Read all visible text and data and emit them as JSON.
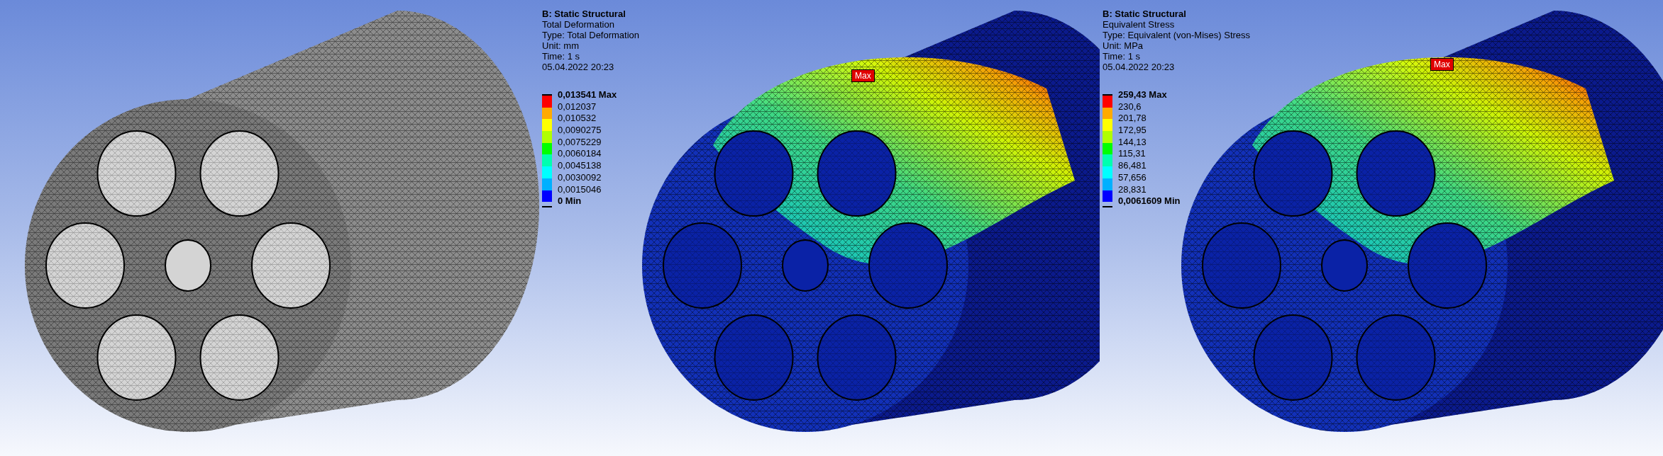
{
  "views": [
    {
      "kind": "mesh"
    },
    {
      "kind": "result",
      "legend": {
        "title": "B: Static Structural",
        "lines": [
          "Total Deformation",
          "Type: Total Deformation",
          "Unit: mm",
          "Time: 1 s",
          "05.04.2022 20:23"
        ],
        "labels": [
          "0,013541 Max",
          "0,012037",
          "0,010532",
          "0,0090275",
          "0,0075229",
          "0,0060184",
          "0,0045138",
          "0,0030092",
          "0,0015046",
          "0 Min"
        ],
        "bands": [
          {
            "color": "#ff0000"
          },
          {
            "color": "#ffaa00"
          },
          {
            "color": "#ffff00"
          },
          {
            "color": "#b0ff00"
          },
          {
            "color": "#00ff00"
          },
          {
            "color": "#00ffb0"
          },
          {
            "color": "#00ffff"
          },
          {
            "color": "#00b0ff"
          },
          {
            "color": "#0000ff"
          }
        ]
      },
      "max_tag": "Max"
    },
    {
      "kind": "result",
      "legend": {
        "title": "B: Static Structural",
        "lines": [
          "Equivalent Stress",
          "Type: Equivalent (von-Mises) Stress",
          "Unit: MPa",
          "Time: 1 s",
          "05.04.2022 20:23"
        ],
        "labels": [
          "259,43 Max",
          "230,6",
          "201,78",
          "172,95",
          "144,13",
          "115,31",
          "86,481",
          "57,656",
          "28,831",
          "0,0061609 Min"
        ],
        "bands": [
          {
            "color": "#ff0000"
          },
          {
            "color": "#ffaa00"
          },
          {
            "color": "#ffff00"
          },
          {
            "color": "#b0ff00"
          },
          {
            "color": "#00ff00"
          },
          {
            "color": "#00ffb0"
          },
          {
            "color": "#00ffff"
          },
          {
            "color": "#00b0ff"
          },
          {
            "color": "#0000ff"
          }
        ]
      },
      "max_tag": "Max"
    }
  ]
}
